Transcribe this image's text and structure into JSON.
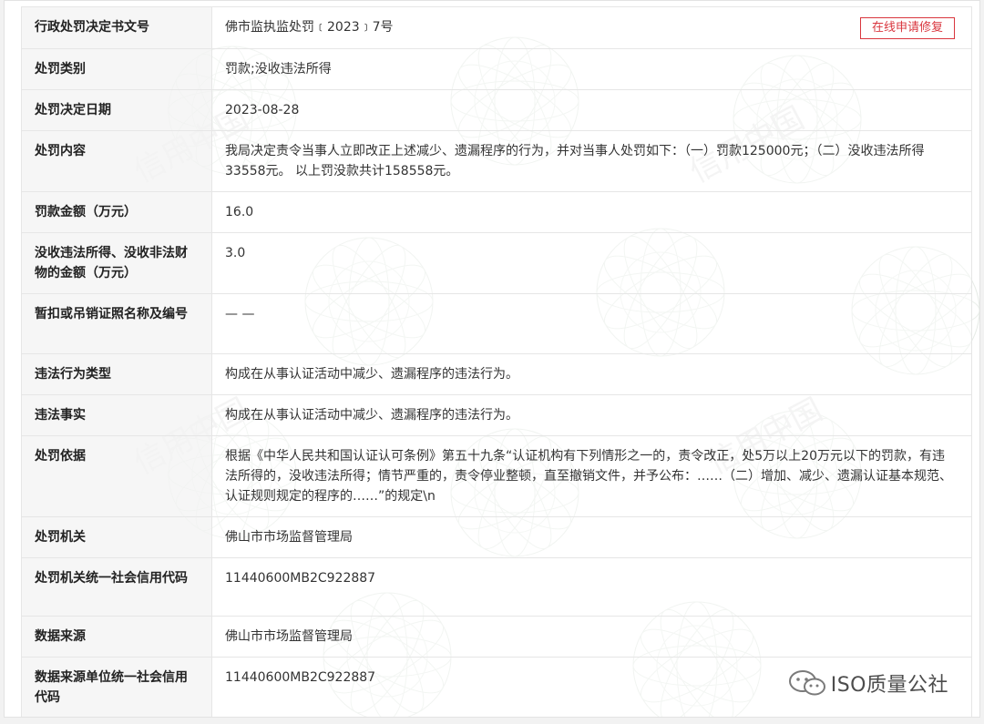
{
  "actions": {
    "repair_label": "在线申请修复"
  },
  "rows": [
    {
      "label": "行政处罚决定书文号",
      "value": "佛市监执监处罚﹝2023﹞7号"
    },
    {
      "label": "处罚类别",
      "value": "罚款;没收违法所得"
    },
    {
      "label": "处罚决定日期",
      "value": "2023-08-28"
    },
    {
      "label": "处罚内容",
      "value": "我局决定责令当事人立即改正上述减少、遗漏程序的行为，并对当事人处罚如下：（一）罚款125000元；（二）没收违法所得33558元。 以上罚没款共计158558元。"
    },
    {
      "label": "罚款金额（万元）",
      "value": "16.0"
    },
    {
      "label": "没收违法所得、没收非法财物的金额（万元）",
      "value": "3.0"
    },
    {
      "label": "暂扣或吊销证照名称及编号",
      "value": "— —"
    },
    {
      "label": "违法行为类型",
      "value": "构成在从事认证活动中减少、遗漏程序的违法行为。"
    },
    {
      "label": "违法事实",
      "value": "构成在从事认证活动中减少、遗漏程序的违法行为。"
    },
    {
      "label": "处罚依据",
      "value": "根据《中华人民共和国认证认可条例》第五十九条“认证机构有下列情形之一的，责令改正，处5万以上20万元以下的罚款，有违法所得的，没收违法所得；情节严重的，责令停业整顿，直至撤销文件，并予公布：……（二）增加、减少、遗漏认证基本规范、认证规则规定的程序的……”的规定\\n"
    },
    {
      "label": "处罚机关",
      "value": "佛山市市场监督管理局"
    },
    {
      "label": "处罚机关统一社会信用代码",
      "value": "11440600MB2C922887"
    },
    {
      "label": "数据来源",
      "value": "佛山市市场监督管理局"
    },
    {
      "label": "数据来源单位统一社会信用代码",
      "value": "11440600MB2C922887"
    }
  ],
  "watermark": {
    "text": "信用中国"
  },
  "brand": {
    "name": "ISO质量公社",
    "icon": "wechat-icon"
  },
  "colors": {
    "accent": "#d9363e",
    "label_bg": "#f4f4f4",
    "border": "#e6e6e6"
  }
}
